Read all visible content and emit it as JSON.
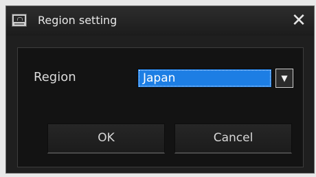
{
  "dialog": {
    "title": "Region setting",
    "close_glyph": "✕",
    "app_icon": "monitor-icon"
  },
  "form": {
    "region_label": "Region",
    "region_value": "Japan",
    "dropdown_glyph": "▼"
  },
  "buttons": {
    "ok_label": "OK",
    "cancel_label": "Cancel"
  },
  "colors": {
    "selection": "#1d7ee4",
    "window_bg": "#1f1f1f",
    "panel_bg": "#131313"
  }
}
